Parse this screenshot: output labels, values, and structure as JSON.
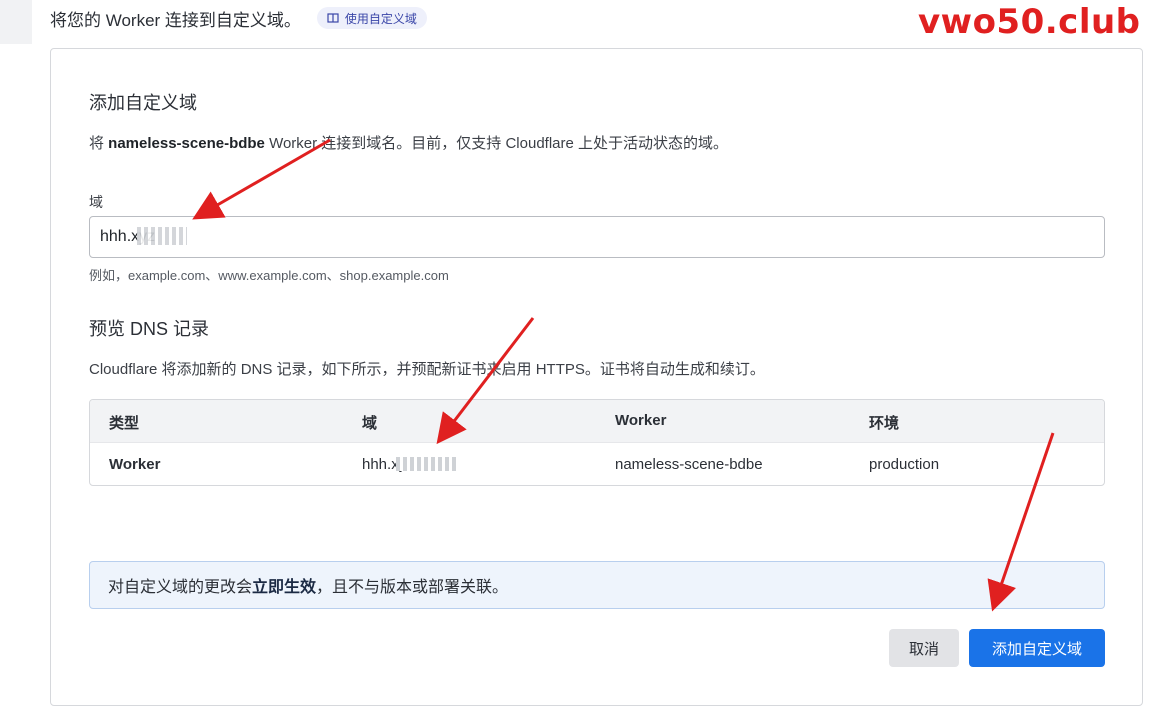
{
  "header": {
    "text": "将您的 Worker 连接到自定义域。",
    "doc_link": "使用自定义域"
  },
  "watermark": "vwo50.club",
  "form": {
    "title": "添加自定义域",
    "desc_prefix": "将 ",
    "worker_name": "nameless-scene-bdbe",
    "desc_suffix": " Worker 连接到域名。目前，仅支持 Cloudflare 上处于活动状态的域。",
    "domain_label": "域",
    "domain_value": "hhh.xyz",
    "domain_hint": "例如，example.com、www.example.com、shop.example.com"
  },
  "preview": {
    "title": "预览 DNS 记录",
    "desc": "Cloudflare 将添加新的 DNS 记录，如下所示，并预配新证书来启用 HTTPS。证书将自动生成和续订。",
    "columns": [
      "类型",
      "域",
      "Worker",
      "环境"
    ],
    "row": [
      "Worker",
      "hhh.xyz",
      "nameless-scene-bdbe",
      "production"
    ]
  },
  "notice": {
    "prefix": "对自定义域的更改会",
    "emphasis": "立即生效",
    "suffix": "，且不与版本或部署关联。"
  },
  "buttons": {
    "cancel": "取消",
    "add": "添加自定义域"
  },
  "colors": {
    "primary": "#1a73e8",
    "arrow": "#e02020",
    "notice_bg": "#eef4fc"
  }
}
